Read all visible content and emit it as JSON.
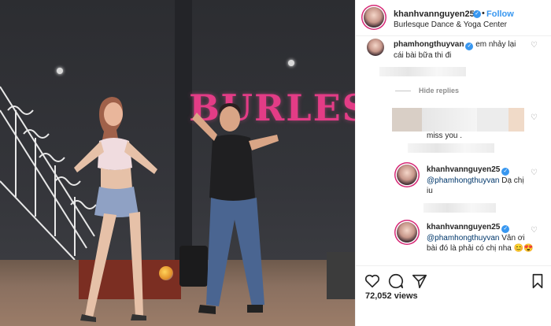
{
  "video": {
    "sign_text": "BURLESQ"
  },
  "post": {
    "username": "khanhvannguyen25",
    "follow_label": "Follow",
    "location": "Burlesque Dance & Yoga Center",
    "dot": "•",
    "verified_glyph": "✓"
  },
  "comments": {
    "c1_user": "phamhongthuyvan",
    "c1_text": "em nhảy lại cái bài bữa thi đi",
    "hide_replies": "Hide replies",
    "c2_text": "miss you .",
    "r1_user": "khanhvannguyen25",
    "r1_mention": "@phamhongthuyvan",
    "r1_text": "Dạ chị iu",
    "r2_user": "khanhvannguyen25",
    "r2_mention": "@phamhongthuyvan",
    "r2_text": "Vân ơi bài đó là phải có chị nha 😊😍",
    "heart_glyph": "♡"
  },
  "actions": {
    "views": "72,052 views"
  },
  "colors": {
    "accent": "#3897f0",
    "sign": "#e33c86",
    "text": "#262626",
    "muted": "#8e8e8e"
  }
}
